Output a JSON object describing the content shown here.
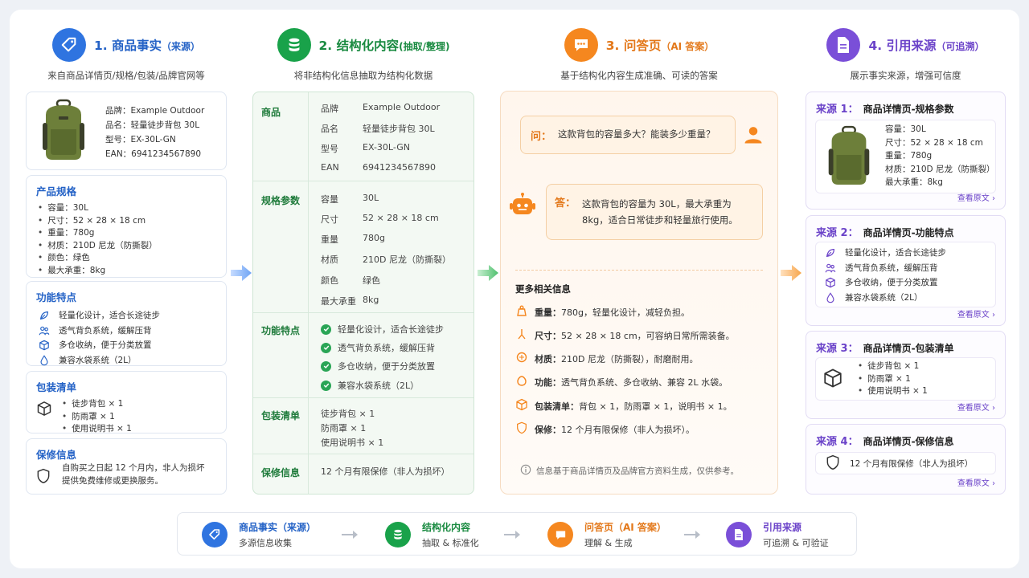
{
  "col1": {
    "num": "1.",
    "title": "商品事实",
    "paren": "（来源）",
    "sub": "来自商品详情页/规格/包装/品牌官网等",
    "product": [
      {
        "k": "品牌：",
        "v": "Example Outdoor"
      },
      {
        "k": "品名：",
        "v": "轻量徒步背包 30L"
      },
      {
        "k": "型号：",
        "v": "EX-30L-GN"
      },
      {
        "k": "EAN：",
        "v": "6941234567890"
      }
    ],
    "spec_title": "产品规格",
    "spec": [
      "容量：30L",
      "尺寸：52 × 28 × 18 cm",
      "重量：780g",
      "材质：210D 尼龙（防撕裂）",
      "颜色：绿色",
      "最大承重：8kg"
    ],
    "feat_title": "功能特点",
    "feat": [
      "轻量化设计，适合长途徒步",
      "透气背负系统，缓解压背",
      "多仓收纳，便于分类放置",
      "兼容水袋系统（2L）"
    ],
    "pack_title": "包装清单",
    "pack": [
      "徒步背包 × 1",
      "防雨罩 × 1",
      "使用说明书 × 1"
    ],
    "warranty_title": "保修信息",
    "warranty": [
      "自购买之日起 12 个月内，非人为损坏",
      "提供免费维修或更换服务。"
    ]
  },
  "col2": {
    "num": "2.",
    "title": "结构化内容",
    "paren": "(抽取/整理)",
    "sub": "将非结构化信息抽取为结构化数据",
    "sec_product": "商品",
    "product": [
      {
        "k": "品牌",
        "v": "Example Outdoor"
      },
      {
        "k": "品名",
        "v": "轻量徒步背包 30L"
      },
      {
        "k": "型号",
        "v": "EX-30L-GN"
      },
      {
        "k": "EAN",
        "v": "6941234567890"
      }
    ],
    "sec_spec": "规格参数",
    "spec": [
      {
        "k": "容量",
        "v": "30L"
      },
      {
        "k": "尺寸",
        "v": "52 × 28 × 18 cm"
      },
      {
        "k": "重量",
        "v": "780g"
      },
      {
        "k": "材质",
        "v": "210D 尼龙（防撕裂）"
      },
      {
        "k": "颜色",
        "v": "绿色"
      },
      {
        "k": "最大承重",
        "v": "8kg"
      }
    ],
    "sec_feat": "功能特点",
    "feat": [
      "轻量化设计，适合长途徒步",
      "透气背负系统，缓解压背",
      "多仓收纳，便于分类放置",
      "兼容水袋系统（2L）"
    ],
    "sec_pack": "包装清单",
    "pack": [
      "徒步背包 × 1",
      "防雨罩 × 1",
      "使用说明书 × 1"
    ],
    "sec_warranty": "保修信息",
    "warranty": "12 个月有限保修（非人为损坏）"
  },
  "col3": {
    "num": "3.",
    "title": "问答页",
    "paren": "（AI 答案）",
    "sub": "基于结构化内容生成准确、可读的答案",
    "q_label": "问：",
    "question": "这款背包的容量多大？能装多少重量？",
    "a_label": "答：",
    "answer": "这款背包的容量为 30L，最大承重为 8kg，适合日常徒步和轻量旅行使用。",
    "more_title": "更多相关信息",
    "more": [
      {
        "k": "重量：",
        "v": "780g，轻量化设计，减轻负担。"
      },
      {
        "k": "尺寸：",
        "v": "52 × 28 × 18 cm，可容纳日常所需装备。"
      },
      {
        "k": "材质：",
        "v": "210D 尼龙（防撕裂），耐磨耐用。"
      },
      {
        "k": "功能：",
        "v": "透气背负系统、多仓收纳、兼容 2L 水袋。"
      },
      {
        "k": "包装清单：",
        "v": "背包 × 1，防雨罩 × 1，说明书 × 1。"
      },
      {
        "k": "保修：",
        "v": "12 个月有限保修（非人为损坏）。"
      }
    ],
    "note": "信息基于商品详情页及品牌官方资料生成，仅供参考。"
  },
  "col4": {
    "num": "4.",
    "title": "引用来源",
    "paren": "（可追溯）",
    "sub": "展示事实来源，增强可信度",
    "view": "查看原文 ›",
    "s1_label": "来源 1：",
    "s1_title": "商品详情页-规格参数",
    "s1_items": [
      "容量：30L",
      "尺寸：52 × 28 × 18 cm",
      "重量：780g",
      "材质：210D 尼龙（防撕裂）",
      "最大承重：8kg"
    ],
    "s2_label": "来源 2：",
    "s2_title": "商品详情页-功能特点",
    "s2_items": [
      "轻量化设计，适合长途徒步",
      "透气背负系统，缓解压背",
      "多仓收纳，便于分类放置",
      "兼容水袋系统（2L）"
    ],
    "s3_label": "来源 3：",
    "s3_title": "商品详情页-包装清单",
    "s3_items": [
      "徒步背包 × 1",
      "防雨罩 × 1",
      "使用说明书 × 1"
    ],
    "s4_label": "来源 4：",
    "s4_title": "商品详情页-保修信息",
    "s4_text": "12 个月有限保修（非人为损坏）"
  },
  "bottom": [
    {
      "name": "商品事实（来源）",
      "desc": "多源信息收集"
    },
    {
      "name": "结构化内容",
      "desc": "抽取 & 标准化"
    },
    {
      "name": "问答页（AI 答案）",
      "desc": "理解 & 生成"
    },
    {
      "name": "引用来源",
      "desc": "可追溯 & 可验证"
    }
  ],
  "colors": {
    "blue": "#2f74e0",
    "green": "#19a24a",
    "orange": "#f5871f",
    "purple": "#7a4fd8"
  }
}
